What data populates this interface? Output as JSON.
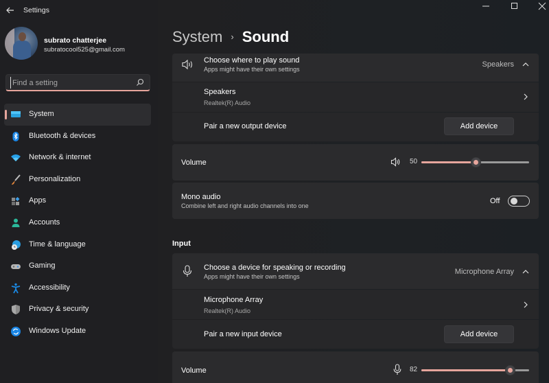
{
  "window": {
    "title": "Settings",
    "controls": [
      "minimize",
      "maximize",
      "close"
    ]
  },
  "profile": {
    "name": "subrato chatterjee",
    "email": "subratocool525@gmail.com"
  },
  "search": {
    "placeholder": "Find a setting",
    "value": ""
  },
  "sidebar": {
    "selected": "System",
    "accent": "#e6a59c",
    "items": [
      {
        "label": "System",
        "icon": "monitor-icon"
      },
      {
        "label": "Bluetooth & devices",
        "icon": "bluetooth-icon"
      },
      {
        "label": "Network & internet",
        "icon": "wifi-icon"
      },
      {
        "label": "Personalization",
        "icon": "brush-icon"
      },
      {
        "label": "Apps",
        "icon": "apps-icon"
      },
      {
        "label": "Accounts",
        "icon": "person-icon"
      },
      {
        "label": "Time & language",
        "icon": "globe-clock-icon"
      },
      {
        "label": "Gaming",
        "icon": "gamepad-icon"
      },
      {
        "label": "Accessibility",
        "icon": "accessibility-icon"
      },
      {
        "label": "Privacy & security",
        "icon": "shield-icon"
      },
      {
        "label": "Windows Update",
        "icon": "update-icon"
      }
    ]
  },
  "breadcrumb": {
    "parent": "System",
    "separator": "›",
    "current": "Sound"
  },
  "output": {
    "choose": {
      "title": "Choose where to play sound",
      "subtitle": "Apps might have their own settings",
      "value": "Speakers",
      "expanded": true
    },
    "device": {
      "name": "Speakers",
      "driver": "Realtek(R) Audio"
    },
    "pair": {
      "label": "Pair a new output device",
      "button": "Add device"
    },
    "volume": {
      "label": "Volume",
      "value": 50
    },
    "mono": {
      "title": "Mono audio",
      "subtitle": "Combine left and right audio channels into one",
      "state": "Off"
    }
  },
  "input": {
    "section_title": "Input",
    "choose": {
      "title": "Choose a device for speaking or recording",
      "subtitle": "Apps might have their own settings",
      "value": "Microphone Array",
      "expanded": true
    },
    "device": {
      "name": "Microphone Array",
      "driver": "Realtek(R) Audio"
    },
    "pair": {
      "label": "Pair a new input device",
      "button": "Add device"
    },
    "volume": {
      "label": "Volume",
      "value": 82
    }
  }
}
